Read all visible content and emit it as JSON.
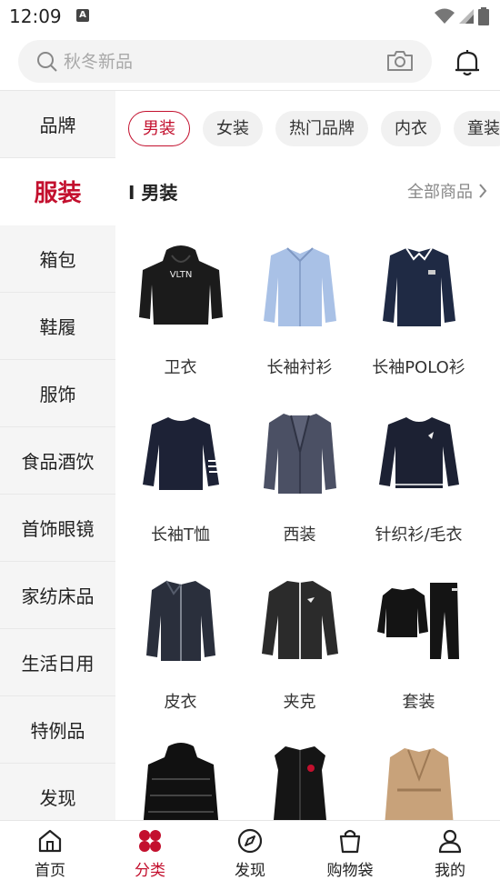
{
  "status": {
    "time": "12:09",
    "badge": "A"
  },
  "search": {
    "placeholder": "秋冬新品"
  },
  "sidebar": {
    "items": [
      {
        "label": "品牌"
      },
      {
        "label": "服装"
      },
      {
        "label": "箱包"
      },
      {
        "label": "鞋履"
      },
      {
        "label": "服饰"
      },
      {
        "label": "食品酒饮"
      },
      {
        "label": "首饰眼镜"
      },
      {
        "label": "家纺床品"
      },
      {
        "label": "生活日用"
      },
      {
        "label": "特例品"
      },
      {
        "label": "发现"
      }
    ],
    "active_index": 1
  },
  "chips": [
    {
      "label": "男装"
    },
    {
      "label": "女装"
    },
    {
      "label": "热门品牌"
    },
    {
      "label": "内衣"
    },
    {
      "label": "童装"
    }
  ],
  "section": {
    "title": "I 男装",
    "more": "全部商品"
  },
  "products": [
    {
      "label": "卫衣",
      "icon": "hoodie",
      "color": "#1b1b1b"
    },
    {
      "label": "长袖衬衫",
      "icon": "shirt",
      "color": "#a9c1e6"
    },
    {
      "label": "长袖POLO衫",
      "icon": "polo",
      "color": "#1f2a44"
    },
    {
      "label": "长袖T恤",
      "icon": "tee",
      "color": "#1d2236"
    },
    {
      "label": "西装",
      "icon": "blazer",
      "color": "#4b5064"
    },
    {
      "label": "针织衫/毛衣",
      "icon": "sweater",
      "color": "#1c2133"
    },
    {
      "label": "皮衣",
      "icon": "leather-jacket",
      "color": "#2a2f3c"
    },
    {
      "label": "夹克",
      "icon": "jacket",
      "color": "#2b2b2b"
    },
    {
      "label": "套装",
      "icon": "tracksuit",
      "color": "#141414"
    },
    {
      "label": "",
      "icon": "puffer",
      "color": "#111111"
    },
    {
      "label": "",
      "icon": "vest",
      "color": "#151515"
    },
    {
      "label": "",
      "icon": "trench",
      "color": "#c8a27a"
    }
  ],
  "tabs": [
    {
      "label": "首页",
      "icon": "home-icon"
    },
    {
      "label": "分类",
      "icon": "category-icon"
    },
    {
      "label": "发现",
      "icon": "compass-icon"
    },
    {
      "label": "购物袋",
      "icon": "bag-icon"
    },
    {
      "label": "我的",
      "icon": "user-icon"
    }
  ],
  "colors": {
    "accent": "#c3102e"
  }
}
